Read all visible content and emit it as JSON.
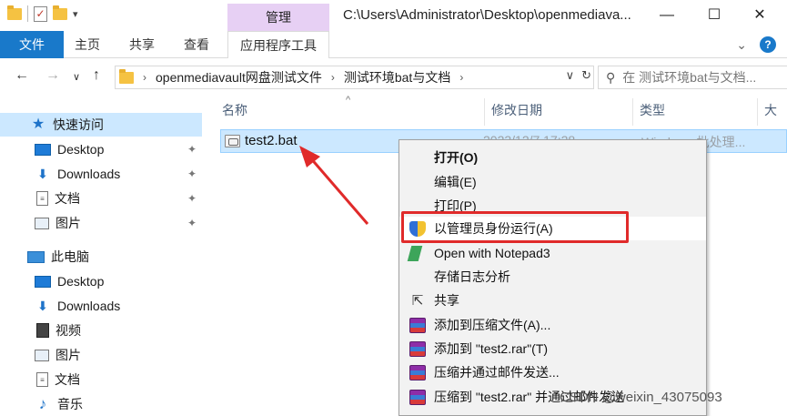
{
  "titlebar": {
    "manage_tab": "管理",
    "path_title": "C:\\Users\\Administrator\\Desktop\\openmediava...",
    "minimize": "—",
    "maximize": "☐",
    "close": "✕",
    "qat_dropdown": "▾"
  },
  "ribbon": {
    "tabs": [
      "文件",
      "主页",
      "共享",
      "查看",
      "应用程序工具"
    ],
    "collapse_icon": "⌄",
    "help": "?"
  },
  "address": {
    "crumbs": [
      "openmediavault网盘测试文件",
      "测试环境bat与文档"
    ],
    "search_placeholder": "在 测试环境bat与文档..."
  },
  "nav": {
    "quick_access": "快速访问",
    "quick_items": [
      "Desktop",
      "Downloads",
      "文档",
      "图片"
    ],
    "this_pc": "此电脑",
    "pc_items": [
      "Desktop",
      "Downloads",
      "视频",
      "图片",
      "文档",
      "音乐"
    ]
  },
  "columns": {
    "name": "名称",
    "modified": "修改日期",
    "type": "类型",
    "size": "大小"
  },
  "file": {
    "name": "test2.bat",
    "modified": "2023/12/7 17:28",
    "type": "Windows 批处理..."
  },
  "context_menu": {
    "items": [
      {
        "label": "打开(O)",
        "icon": "none",
        "bold": true
      },
      {
        "label": "编辑(E)",
        "icon": "none"
      },
      {
        "label": "打印(P)",
        "icon": "none"
      },
      {
        "label": "以管理员身份运行(A)",
        "icon": "uac-shield-icon",
        "highlighted": true
      },
      {
        "label": "Open with Notepad3",
        "icon": "notepad3-icon"
      },
      {
        "label": "存储日志分析",
        "icon": "none"
      },
      {
        "label": "共享",
        "icon": "share-icon"
      },
      {
        "label": "添加到压缩文件(A)...",
        "icon": "winrar-icon"
      },
      {
        "label": "添加到 \"test2.rar\"(T)",
        "icon": "winrar-icon"
      },
      {
        "label": "压缩并通过邮件发送...",
        "icon": "winrar-icon"
      },
      {
        "label": "压缩到 \"test2.rar\" 并通过邮件发送",
        "icon": "winrar-icon"
      }
    ]
  },
  "watermark": "CSDN @weixin_43075093",
  "colors": {
    "accent": "#1979ca",
    "manage_tab_bg": "#e7d0f4",
    "selection": "#cce8ff",
    "annotation_red": "#e02a2a"
  }
}
